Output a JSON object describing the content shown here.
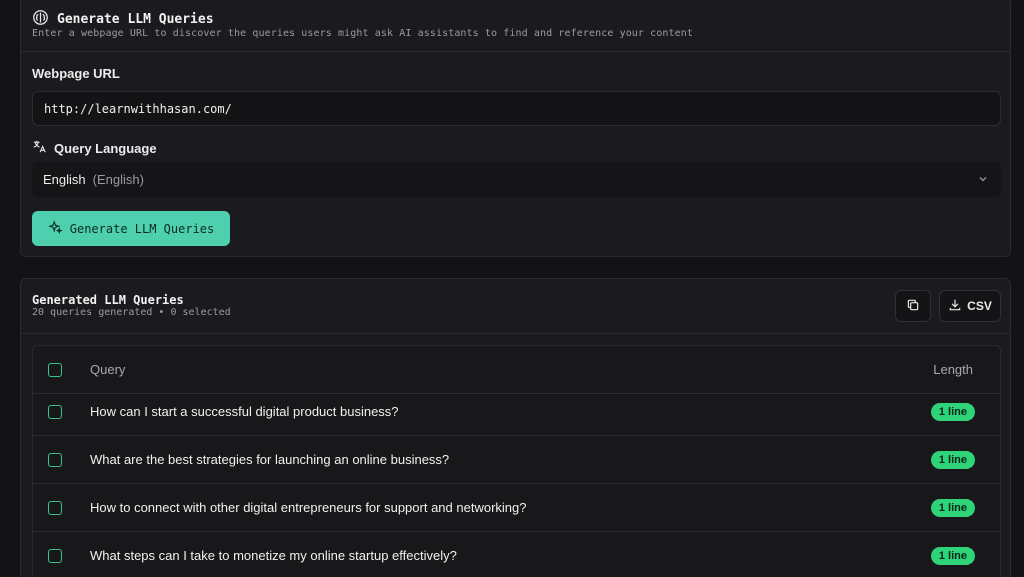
{
  "header": {
    "title": "Generate LLM Queries",
    "subtitle": "Enter a webpage URL to discover the queries users might ask AI assistants to find and reference your content"
  },
  "form": {
    "url_label": "Webpage URL",
    "url_value": "http://learnwithhasan.com/",
    "language_label": "Query Language",
    "language_value": "English",
    "language_native": "(English)",
    "generate_label": "Generate LLM Queries"
  },
  "results": {
    "title": "Generated LLM Queries",
    "subtitle": "20 queries generated • 0 selected",
    "csv_label": "CSV",
    "columns": {
      "query": "Query",
      "length": "Length"
    },
    "rows": [
      {
        "query": "How can I start a successful digital product business?",
        "length": "1 line"
      },
      {
        "query": "What are the best strategies for launching an online business?",
        "length": "1 line"
      },
      {
        "query": "How to connect with other digital entrepreneurs for support and networking?",
        "length": "1 line"
      },
      {
        "query": "What steps can I take to monetize my online startup effectively?",
        "length": "1 line"
      }
    ]
  },
  "colors": {
    "accent": "#4ecfae",
    "badge": "#2fd47a",
    "background": "#131316"
  }
}
